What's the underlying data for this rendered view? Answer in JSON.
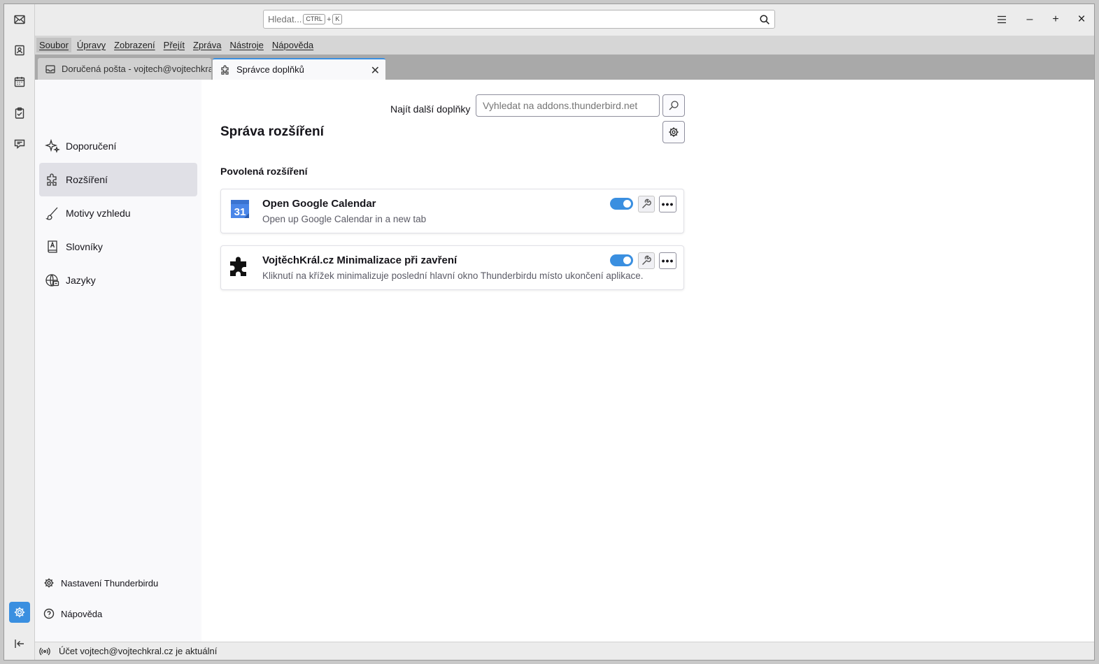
{
  "titlebar": {
    "search_placeholder": "Hledat...",
    "shortcut_key1": "CTRL",
    "shortcut_plus": "+",
    "shortcut_key2": "K",
    "menu_icon": "hamburger-icon",
    "minimize": "–",
    "maximize": "+",
    "close": "×"
  },
  "menubar": {
    "items": [
      "Soubor",
      "Úpravy",
      "Zobrazení",
      "Přejít",
      "Zpráva",
      "Nástroje",
      "Nápověda"
    ]
  },
  "tabs": [
    {
      "label": "Doručená pošta - vojtech@vojtechkral.cz",
      "icon": "inbox-icon"
    },
    {
      "label": "Správce doplňků",
      "icon": "puzzle-icon",
      "close": "✕"
    }
  ],
  "sidebar": {
    "items": [
      {
        "label": "Doporučení",
        "icon": "sparkle-icon"
      },
      {
        "label": "Rozšíření",
        "icon": "puzzle-icon"
      },
      {
        "label": "Motivy vzhledu",
        "icon": "brush-icon"
      },
      {
        "label": "Slovníky",
        "icon": "dictionary-icon"
      },
      {
        "label": "Jazyky",
        "icon": "globe-icon"
      }
    ],
    "footer": [
      {
        "label": "Nastavení Thunderbirdu",
        "icon": "gear-icon"
      },
      {
        "label": "Nápověda",
        "icon": "help-icon"
      }
    ]
  },
  "main": {
    "find_label": "Najít další doplňky",
    "find_placeholder": "Vyhledat na addons.thunderbird.net",
    "page_title": "Správa rozšíření",
    "section_title": "Povolená rozšíření",
    "addons": [
      {
        "name": "Open Google Calendar",
        "description": "Open up Google Calendar in a new tab",
        "icon": "google-calendar-icon",
        "icon_text": "31",
        "enabled": true
      },
      {
        "name": "VojtěchKrál.cz Minimalizace při zavření",
        "description": "Kliknutí na křížek minimalizuje poslední hlavní okno Thunderbirdu místo ukončení aplikace.",
        "icon": "puzzle-icon",
        "enabled": true
      }
    ],
    "more_label": "•••"
  },
  "statusbar": {
    "text": "Účet vojtech@vojtechkral.cz je aktuální",
    "icon": "broadcast-icon"
  },
  "colors": {
    "accent": "#3a8fe0",
    "selected_category": "#e0e0e6"
  }
}
